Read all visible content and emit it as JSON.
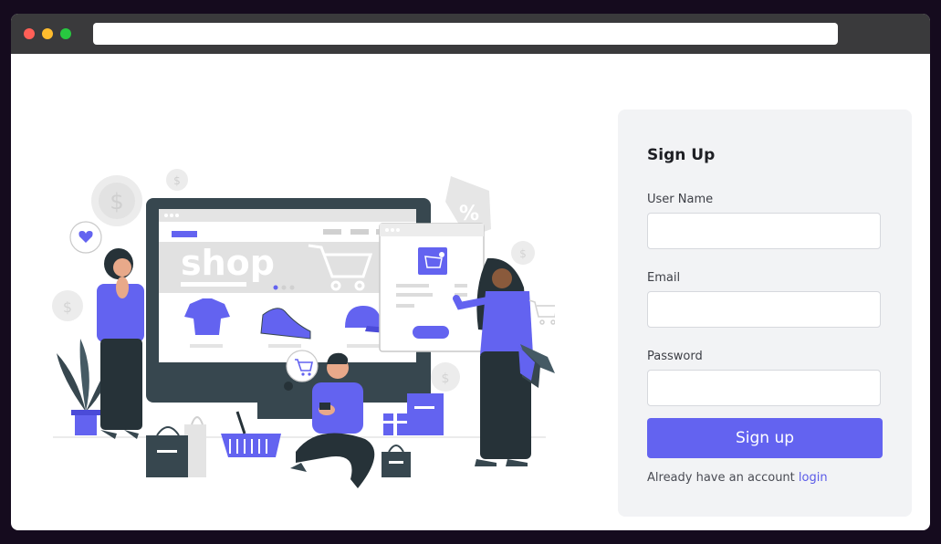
{
  "window": {
    "controls": [
      "close",
      "minimize",
      "maximize"
    ],
    "address_value": ""
  },
  "illustration": {
    "screen_word": "shop",
    "percent_tag": "%",
    "icons": [
      "dollar-coin-icon",
      "heart-icon",
      "cart-icon",
      "shopping-bag-icon",
      "shirt-icon",
      "sneaker-icon",
      "cap-icon",
      "basket-icon",
      "gift-icon",
      "plant-icon"
    ]
  },
  "signup": {
    "title": "Sign Up",
    "username_label": "User Name",
    "username_value": "",
    "email_label": "Email",
    "email_value": "",
    "password_label": "Password",
    "password_value": "",
    "submit_label": "Sign up",
    "footer_text": "Already have an account",
    "login_link": "login"
  },
  "colors": {
    "accent": "#6363f0",
    "background": "#150b1e",
    "titlebar": "#3a3a3c",
    "card": "#f2f3f5",
    "monitor": "#37474f"
  }
}
